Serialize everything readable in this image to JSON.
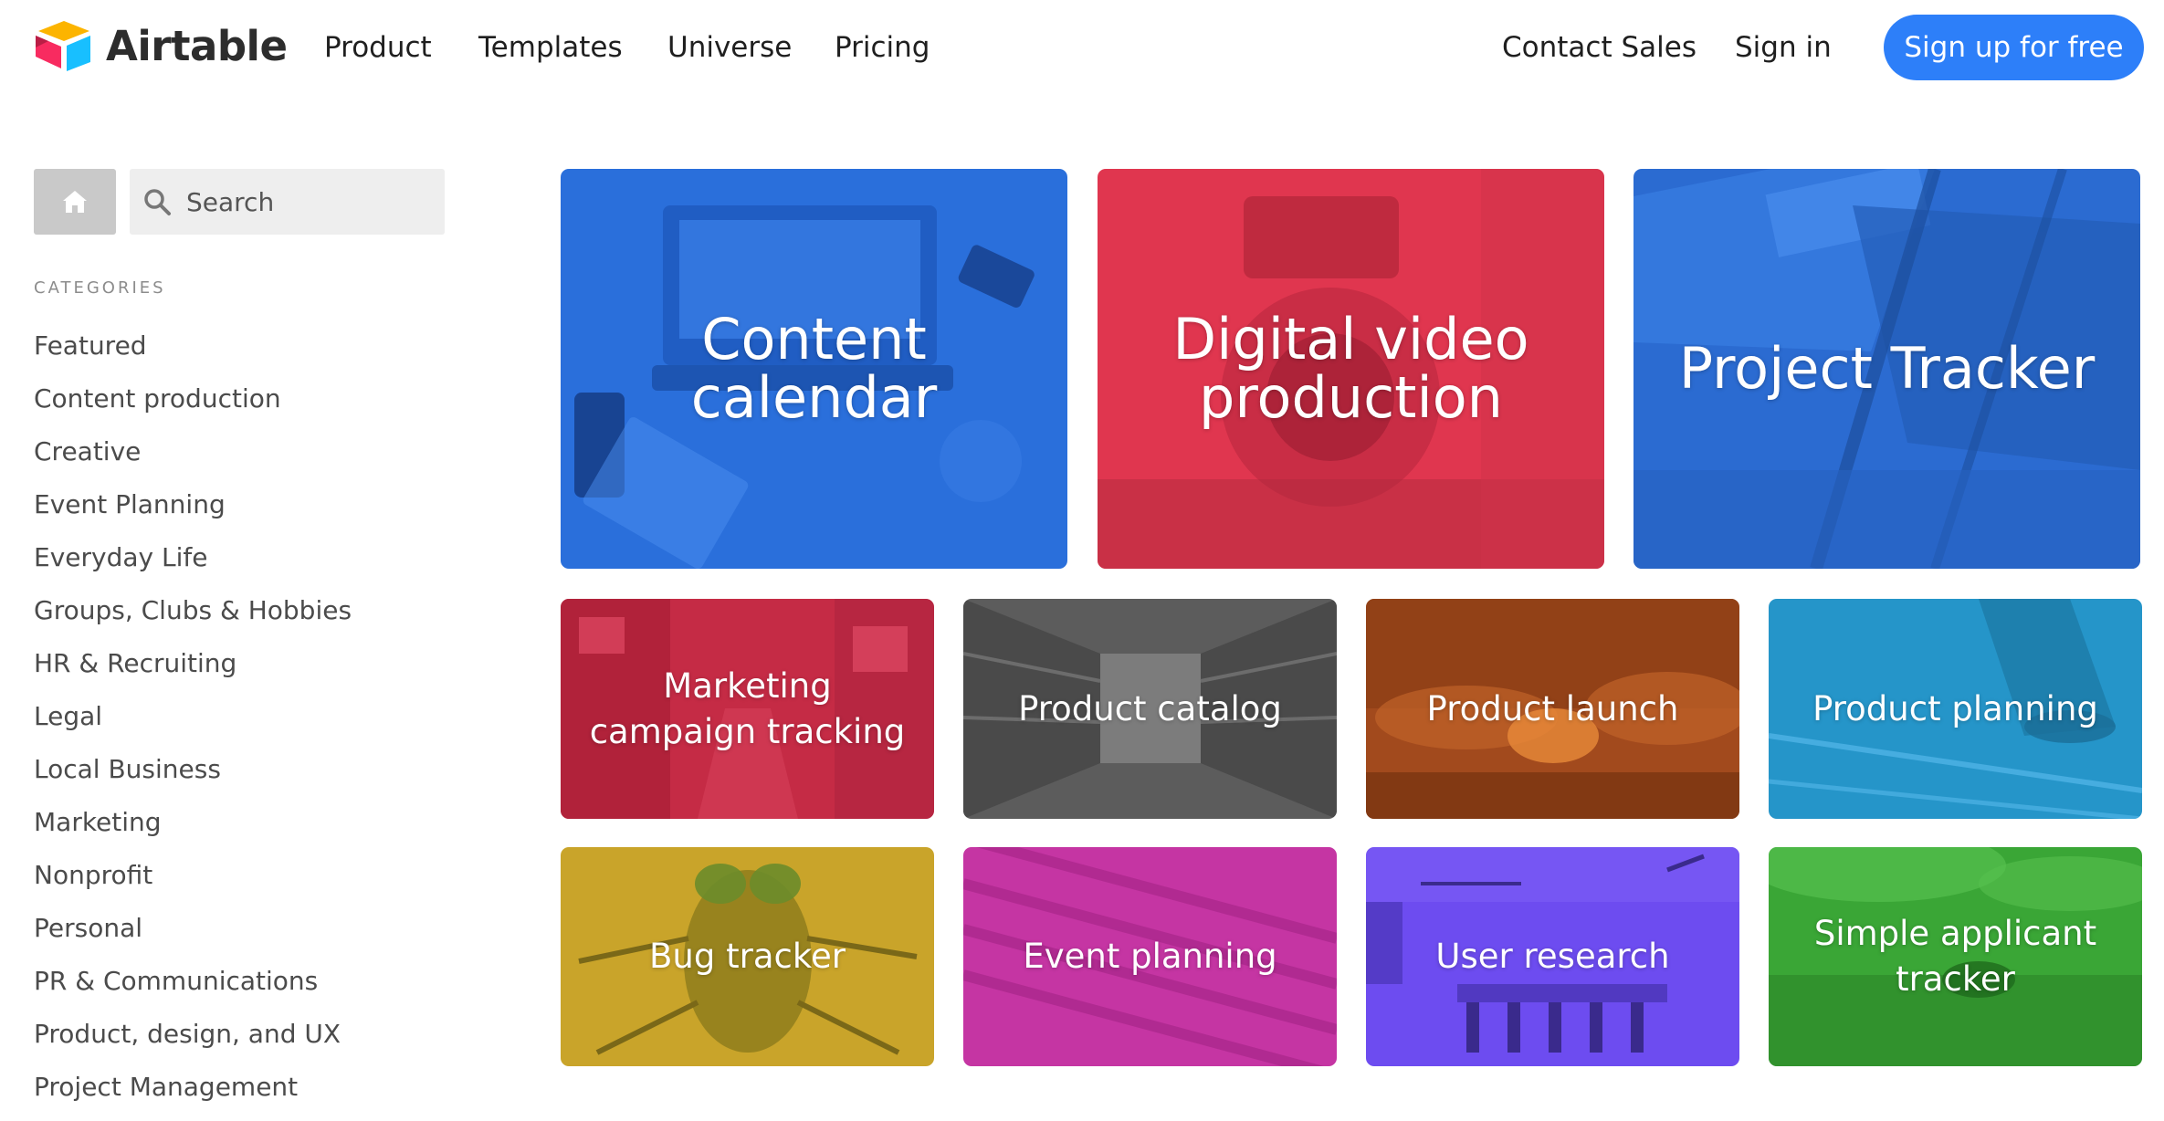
{
  "header": {
    "logo_text": "Airtable",
    "nav": [
      {
        "label": "Product"
      },
      {
        "label": "Templates"
      },
      {
        "label": "Universe"
      },
      {
        "label": "Pricing"
      }
    ],
    "contact_sales": "Contact Sales",
    "sign_in": "Sign in",
    "sign_up": "Sign up for free",
    "accent_color": "#2d7ff9"
  },
  "sidebar": {
    "home_icon": "home-icon",
    "search": {
      "placeholder": "Search",
      "value": ""
    },
    "categories_heading": "CATEGORIES",
    "categories": [
      "Featured",
      "Content production",
      "Creative",
      "Event Planning",
      "Everyday Life",
      "Groups, Clubs & Hobbies",
      "HR & Recruiting",
      "Legal",
      "Local Business",
      "Marketing",
      "Nonprofit",
      "Personal",
      "PR & Communications",
      "Product, design, and UX",
      "Project Management"
    ]
  },
  "templates": {
    "featured": [
      {
        "title": "Content calendar",
        "color": "#2a6fdb"
      },
      {
        "title": "Digital video production",
        "color": "#e0364f"
      },
      {
        "title": "Project Tracker",
        "color": "#2b6bd1"
      }
    ],
    "row2": [
      {
        "title": "Marketing campaign tracking",
        "color": "#c52b45"
      },
      {
        "title": "Product catalog",
        "color": "#5c5c5c"
      },
      {
        "title": "Product launch",
        "color": "#a24a1d"
      },
      {
        "title": "Product planning",
        "color": "#2595c9"
      }
    ],
    "row3": [
      {
        "title": "Bug tracker",
        "color": "#c9a42a"
      },
      {
        "title": "Event planning",
        "color": "#c232a0"
      },
      {
        "title": "User research",
        "color": "#6d4cf0"
      },
      {
        "title": "Simple applicant tracker",
        "color": "#3aa636"
      }
    ]
  }
}
